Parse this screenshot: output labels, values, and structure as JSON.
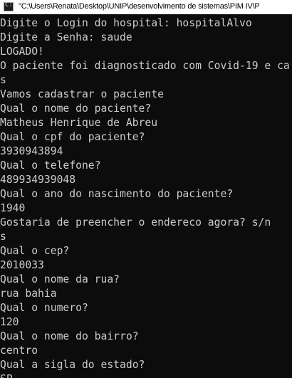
{
  "window": {
    "title": "\"C:\\Users\\Renata\\Desktop\\UNIP\\desenvolvimento de sistemas\\PIM IV\\P",
    "icon": "console-app-icon"
  },
  "console": {
    "lines": [
      "Digite o Login do hospital: hospitalAlvo",
      "Digite a Senha: saude",
      "LOGADO!",
      "O paciente foi diagnosticado com Covid-19 e ca",
      "s",
      "Vamos cadastrar o paciente",
      "Qual o nome do paciente?",
      "Matheus Henrique de Abreu",
      "Qual o cpf do paciente?",
      "3930943894",
      "Qual o telefone?",
      "489934939048",
      "Qual o ano do nascimento do paciente?",
      "1940",
      "Gostaria de preencher o endereco agora? s/n",
      "s",
      "Qual o cep?",
      "2010033",
      "Qual o nome da rua?",
      "rua bahia",
      "Qual o numero?",
      "120",
      "Qual o nome do bairro?",
      "centro",
      "Qual a sigla do estado?",
      "SP"
    ]
  },
  "colors": {
    "console_background": "#0c0c0c",
    "console_text": "#cccccc",
    "titlebar_background": "#ffffff"
  }
}
